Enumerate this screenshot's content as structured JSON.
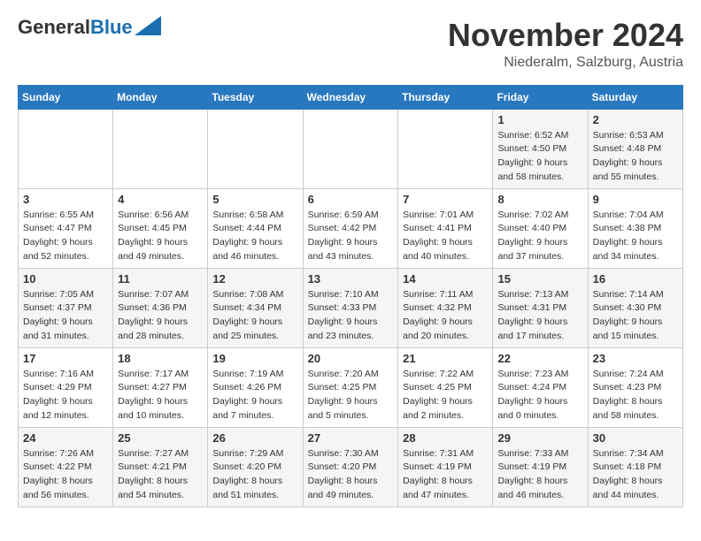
{
  "logo": {
    "line1": "General",
    "line2": "Blue"
  },
  "title": "November 2024",
  "location": "Niederalm, Salzburg, Austria",
  "weekdays": [
    "Sunday",
    "Monday",
    "Tuesday",
    "Wednesday",
    "Thursday",
    "Friday",
    "Saturday"
  ],
  "weeks": [
    [
      {
        "day": "",
        "sunrise": "",
        "sunset": "",
        "daylight": ""
      },
      {
        "day": "",
        "sunrise": "",
        "sunset": "",
        "daylight": ""
      },
      {
        "day": "",
        "sunrise": "",
        "sunset": "",
        "daylight": ""
      },
      {
        "day": "",
        "sunrise": "",
        "sunset": "",
        "daylight": ""
      },
      {
        "day": "",
        "sunrise": "",
        "sunset": "",
        "daylight": ""
      },
      {
        "day": "1",
        "sunrise": "Sunrise: 6:52 AM",
        "sunset": "Sunset: 4:50 PM",
        "daylight": "Daylight: 9 hours and 58 minutes."
      },
      {
        "day": "2",
        "sunrise": "Sunrise: 6:53 AM",
        "sunset": "Sunset: 4:48 PM",
        "daylight": "Daylight: 9 hours and 55 minutes."
      }
    ],
    [
      {
        "day": "3",
        "sunrise": "Sunrise: 6:55 AM",
        "sunset": "Sunset: 4:47 PM",
        "daylight": "Daylight: 9 hours and 52 minutes."
      },
      {
        "day": "4",
        "sunrise": "Sunrise: 6:56 AM",
        "sunset": "Sunset: 4:45 PM",
        "daylight": "Daylight: 9 hours and 49 minutes."
      },
      {
        "day": "5",
        "sunrise": "Sunrise: 6:58 AM",
        "sunset": "Sunset: 4:44 PM",
        "daylight": "Daylight: 9 hours and 46 minutes."
      },
      {
        "day": "6",
        "sunrise": "Sunrise: 6:59 AM",
        "sunset": "Sunset: 4:42 PM",
        "daylight": "Daylight: 9 hours and 43 minutes."
      },
      {
        "day": "7",
        "sunrise": "Sunrise: 7:01 AM",
        "sunset": "Sunset: 4:41 PM",
        "daylight": "Daylight: 9 hours and 40 minutes."
      },
      {
        "day": "8",
        "sunrise": "Sunrise: 7:02 AM",
        "sunset": "Sunset: 4:40 PM",
        "daylight": "Daylight: 9 hours and 37 minutes."
      },
      {
        "day": "9",
        "sunrise": "Sunrise: 7:04 AM",
        "sunset": "Sunset: 4:38 PM",
        "daylight": "Daylight: 9 hours and 34 minutes."
      }
    ],
    [
      {
        "day": "10",
        "sunrise": "Sunrise: 7:05 AM",
        "sunset": "Sunset: 4:37 PM",
        "daylight": "Daylight: 9 hours and 31 minutes."
      },
      {
        "day": "11",
        "sunrise": "Sunrise: 7:07 AM",
        "sunset": "Sunset: 4:36 PM",
        "daylight": "Daylight: 9 hours and 28 minutes."
      },
      {
        "day": "12",
        "sunrise": "Sunrise: 7:08 AM",
        "sunset": "Sunset: 4:34 PM",
        "daylight": "Daylight: 9 hours and 25 minutes."
      },
      {
        "day": "13",
        "sunrise": "Sunrise: 7:10 AM",
        "sunset": "Sunset: 4:33 PM",
        "daylight": "Daylight: 9 hours and 23 minutes."
      },
      {
        "day": "14",
        "sunrise": "Sunrise: 7:11 AM",
        "sunset": "Sunset: 4:32 PM",
        "daylight": "Daylight: 9 hours and 20 minutes."
      },
      {
        "day": "15",
        "sunrise": "Sunrise: 7:13 AM",
        "sunset": "Sunset: 4:31 PM",
        "daylight": "Daylight: 9 hours and 17 minutes."
      },
      {
        "day": "16",
        "sunrise": "Sunrise: 7:14 AM",
        "sunset": "Sunset: 4:30 PM",
        "daylight": "Daylight: 9 hours and 15 minutes."
      }
    ],
    [
      {
        "day": "17",
        "sunrise": "Sunrise: 7:16 AM",
        "sunset": "Sunset: 4:29 PM",
        "daylight": "Daylight: 9 hours and 12 minutes."
      },
      {
        "day": "18",
        "sunrise": "Sunrise: 7:17 AM",
        "sunset": "Sunset: 4:27 PM",
        "daylight": "Daylight: 9 hours and 10 minutes."
      },
      {
        "day": "19",
        "sunrise": "Sunrise: 7:19 AM",
        "sunset": "Sunset: 4:26 PM",
        "daylight": "Daylight: 9 hours and 7 minutes."
      },
      {
        "day": "20",
        "sunrise": "Sunrise: 7:20 AM",
        "sunset": "Sunset: 4:25 PM",
        "daylight": "Daylight: 9 hours and 5 minutes."
      },
      {
        "day": "21",
        "sunrise": "Sunrise: 7:22 AM",
        "sunset": "Sunset: 4:25 PM",
        "daylight": "Daylight: 9 hours and 2 minutes."
      },
      {
        "day": "22",
        "sunrise": "Sunrise: 7:23 AM",
        "sunset": "Sunset: 4:24 PM",
        "daylight": "Daylight: 9 hours and 0 minutes."
      },
      {
        "day": "23",
        "sunrise": "Sunrise: 7:24 AM",
        "sunset": "Sunset: 4:23 PM",
        "daylight": "Daylight: 8 hours and 58 minutes."
      }
    ],
    [
      {
        "day": "24",
        "sunrise": "Sunrise: 7:26 AM",
        "sunset": "Sunset: 4:22 PM",
        "daylight": "Daylight: 8 hours and 56 minutes."
      },
      {
        "day": "25",
        "sunrise": "Sunrise: 7:27 AM",
        "sunset": "Sunset: 4:21 PM",
        "daylight": "Daylight: 8 hours and 54 minutes."
      },
      {
        "day": "26",
        "sunrise": "Sunrise: 7:29 AM",
        "sunset": "Sunset: 4:20 PM",
        "daylight": "Daylight: 8 hours and 51 minutes."
      },
      {
        "day": "27",
        "sunrise": "Sunrise: 7:30 AM",
        "sunset": "Sunset: 4:20 PM",
        "daylight": "Daylight: 8 hours and 49 minutes."
      },
      {
        "day": "28",
        "sunrise": "Sunrise: 7:31 AM",
        "sunset": "Sunset: 4:19 PM",
        "daylight": "Daylight: 8 hours and 47 minutes."
      },
      {
        "day": "29",
        "sunrise": "Sunrise: 7:33 AM",
        "sunset": "Sunset: 4:19 PM",
        "daylight": "Daylight: 8 hours and 46 minutes."
      },
      {
        "day": "30",
        "sunrise": "Sunrise: 7:34 AM",
        "sunset": "Sunset: 4:18 PM",
        "daylight": "Daylight: 8 hours and 44 minutes."
      }
    ]
  ]
}
